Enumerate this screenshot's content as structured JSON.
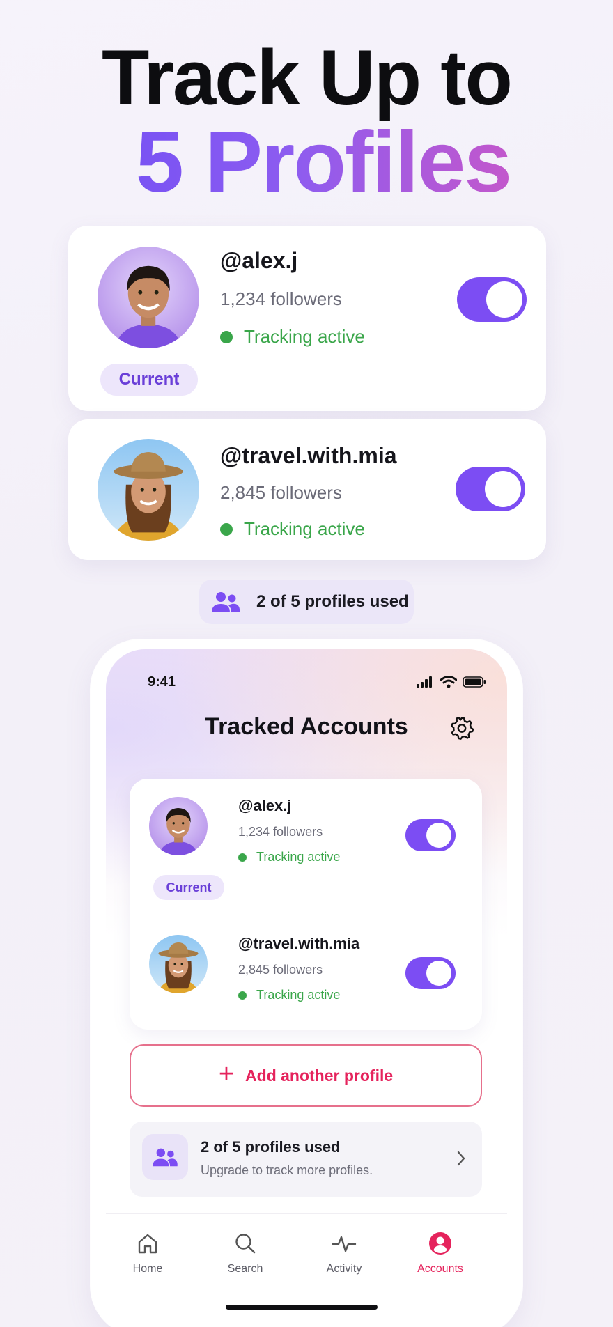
{
  "hero": {
    "line1": "Track Up to",
    "line2": "5 Profiles"
  },
  "profiles": [
    {
      "handle": "@alex.j",
      "followers": "1,234 followers",
      "status": "Tracking active",
      "badge": "Current",
      "tracking_on": true
    },
    {
      "handle": "@travel.with.mia",
      "followers": "2,845 followers",
      "status": "Tracking active",
      "tracking_on": true
    }
  ],
  "usage_pill": {
    "text": "2 of 5 profiles used",
    "icon": "people-icon"
  },
  "phone": {
    "status_bar": {
      "time": "9:41",
      "icons": [
        "signal-icon",
        "wifi-icon",
        "battery-icon"
      ]
    },
    "title": "Tracked Accounts",
    "settings_icon": "gear-icon",
    "add_button": "Add another profile",
    "upgrade": {
      "title": "2 of 5 profiles used",
      "subtitle": "Upgrade to track more profiles."
    },
    "tabs": [
      {
        "label": "Home",
        "icon": "home-icon"
      },
      {
        "label": "Search",
        "icon": "search-icon"
      },
      {
        "label": "Activity",
        "icon": "activity-icon"
      },
      {
        "label": "Accounts",
        "icon": "account-icon",
        "active": true
      }
    ]
  },
  "colors": {
    "accent_purple": "#7c4df3",
    "status_green": "#3aa64a",
    "accent_pink": "#e5235c"
  }
}
